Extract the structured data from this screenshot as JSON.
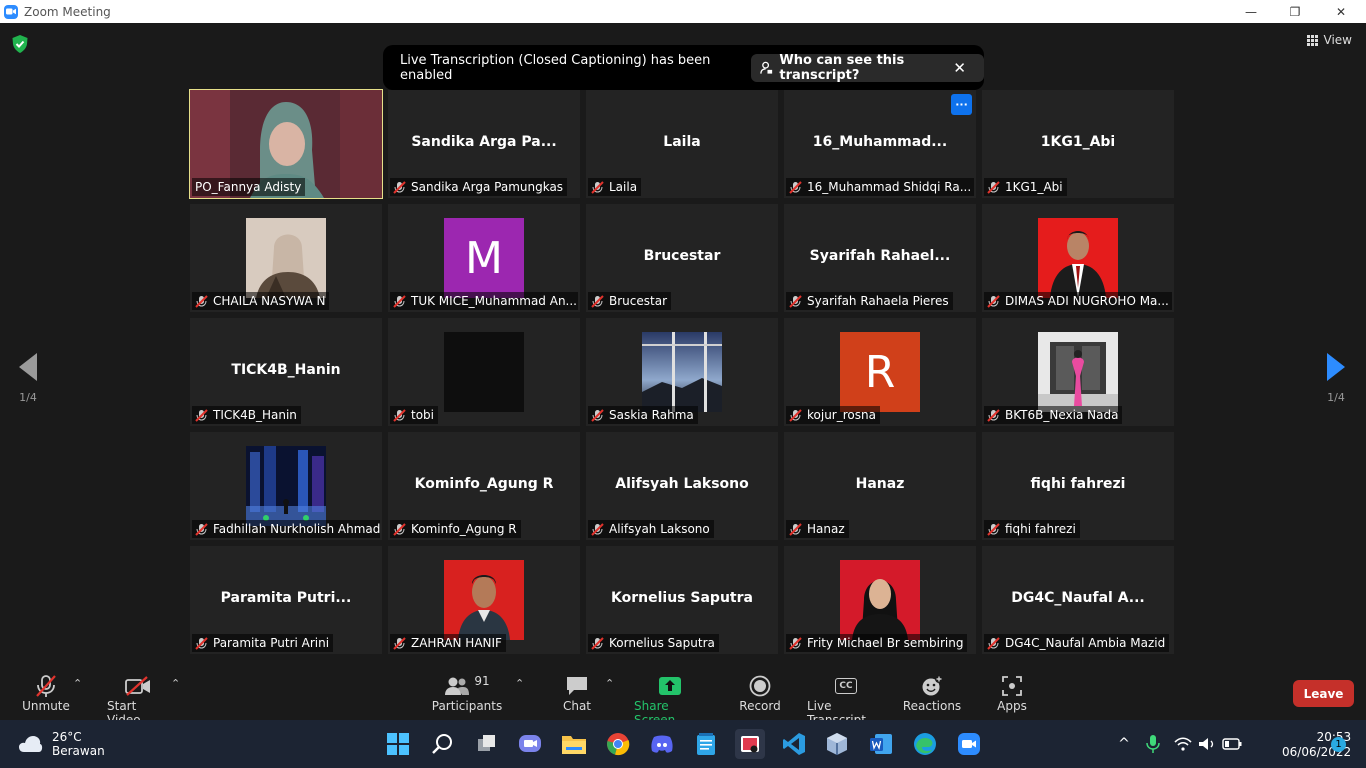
{
  "window": {
    "title": "Zoom Meeting",
    "minimize": "—",
    "restore": "❐",
    "close": "✕"
  },
  "header": {
    "view_label": "View"
  },
  "notice": {
    "text": "Live Transcription (Closed Captioning) has been enabled",
    "who_label": "Who can see this transcript?",
    "close": "✕"
  },
  "pager": {
    "left": "1/4",
    "right": "1/4"
  },
  "tiles": [
    {
      "name": "PO_Fannya Adisty",
      "display": "",
      "kind": "photo"
    },
    {
      "name": "Sandika Arga Pamungkas",
      "display": "Sandika  Arga  Pa...",
      "kind": "text"
    },
    {
      "name": "Laila",
      "display": "Laila",
      "kind": "text"
    },
    {
      "name": "16_Muhammad Shidqi Ra...",
      "display": "16_Muhammad...",
      "kind": "text"
    },
    {
      "name": "1KG1_Abi",
      "display": "1KG1_Abi",
      "kind": "text"
    },
    {
      "name": "CHAILA NASYWA N",
      "display": "",
      "kind": "photo"
    },
    {
      "name": "TUK MICE_Muhammad An...",
      "display": "M",
      "kind": "letter"
    },
    {
      "name": "Brucestar",
      "display": "Brucestar",
      "kind": "text"
    },
    {
      "name": "Syarifah Rahaela Pieres",
      "display": "Syarifah  Rahael...",
      "kind": "text"
    },
    {
      "name": "DIMAS ADI NUGROHO Ma...",
      "display": "",
      "kind": "photo"
    },
    {
      "name": "TICK4B_Hanin",
      "display": "TICK4B_Hanin",
      "kind": "text"
    },
    {
      "name": "tobi",
      "display": "",
      "kind": "black"
    },
    {
      "name": "Saskia Rahma",
      "display": "",
      "kind": "photo"
    },
    {
      "name": "kojur_rosna",
      "display": "R",
      "kind": "letter"
    },
    {
      "name": "BKT6B_Nexia Nada",
      "display": "",
      "kind": "photo"
    },
    {
      "name": "Fadhillah Nurkholish Ahmad",
      "display": "",
      "kind": "photo"
    },
    {
      "name": "Kominfo_Agung R",
      "display": "Kominfo_Agung R",
      "kind": "text"
    },
    {
      "name": "Alifsyah Laksono",
      "display": "Alifsyah Laksono",
      "kind": "text"
    },
    {
      "name": "Hanaz",
      "display": "Hanaz",
      "kind": "text"
    },
    {
      "name": "fiqhi fahrezi",
      "display": "fiqhi fahrezi",
      "kind": "text"
    },
    {
      "name": "Paramita Putri Arini",
      "display": "Paramita  Putri...",
      "kind": "text"
    },
    {
      "name": "ZAHRAN HANIF",
      "display": "",
      "kind": "photo"
    },
    {
      "name": "Kornelius Saputra",
      "display": "Kornelius Saputra",
      "kind": "text"
    },
    {
      "name": "Frity Michael Br sembiring",
      "display": "",
      "kind": "photo"
    },
    {
      "name": "DG4C_Naufal Ambia Mazid",
      "display": "DG4C_Naufal  A...",
      "kind": "text"
    }
  ],
  "toolbar": {
    "unmute": "Unmute",
    "start_video": "Start Video",
    "participants": "Participants",
    "participants_count": "91",
    "chat": "Chat",
    "share_screen": "Share Screen",
    "record": "Record",
    "live_transcript": "Live Transcript",
    "live_transcript_icon": "CC",
    "reactions": "Reactions",
    "apps": "Apps",
    "leave": "Leave",
    "caret": "⌃"
  },
  "taskbar": {
    "temperature": "26°C",
    "weather": "Berawan",
    "time": "20:53",
    "date": "06/06/2022",
    "notifications": "1",
    "chevron": "^"
  },
  "colors": {
    "accent": "#2d8cff",
    "share_green": "#23c36a",
    "leave_red": "#c5302a",
    "active_border": "#e6e08a"
  }
}
